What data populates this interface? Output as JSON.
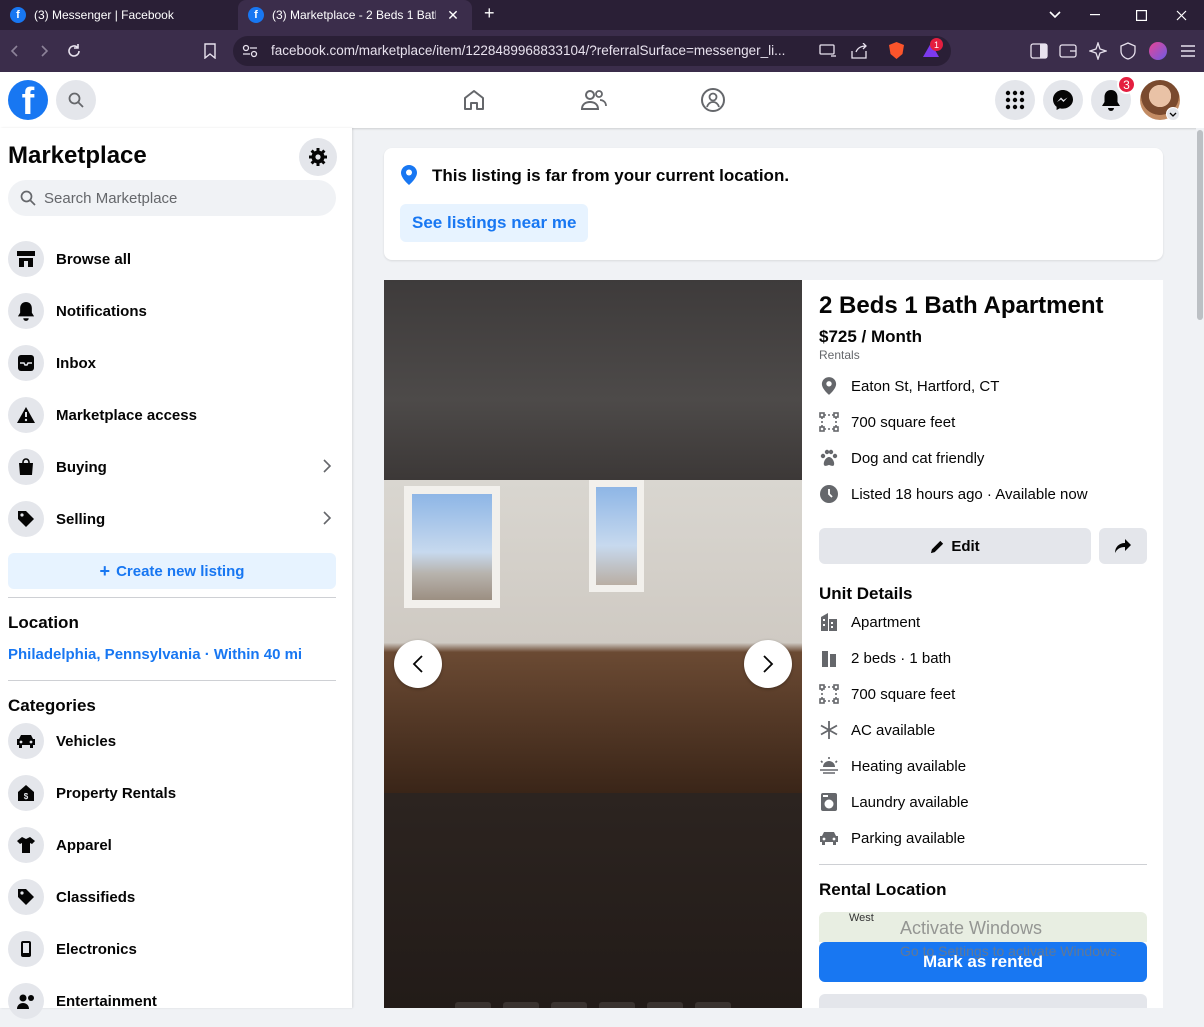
{
  "browser": {
    "tabs": [
      {
        "title": "(3) Messenger | Facebook",
        "active": false
      },
      {
        "title": "(3) Marketplace - 2 Beds 1 Bath",
        "active": true
      }
    ],
    "url": "facebook.com/marketplace/item/1228489968833104/?referralSurface=messenger_li...",
    "brave_badge": "1"
  },
  "fb": {
    "notification_count": "3"
  },
  "sidebar": {
    "title": "Marketplace",
    "search_placeholder": "Search Marketplace",
    "items": [
      {
        "label": "Browse all",
        "icon": "storefront-icon"
      },
      {
        "label": "Notifications",
        "icon": "bell-icon"
      },
      {
        "label": "Inbox",
        "icon": "inbox-icon"
      },
      {
        "label": "Marketplace access",
        "icon": "warning-icon"
      },
      {
        "label": "Buying",
        "icon": "shopping-bag-icon"
      },
      {
        "label": "Selling",
        "icon": "price-tag-icon"
      }
    ],
    "create_label": "Create new listing",
    "location_heading": "Location",
    "location_value": "Philadelphia, Pennsylvania · Within 40 mi",
    "categories_heading": "Categories",
    "categories": [
      {
        "label": "Vehicles",
        "icon": "car-icon"
      },
      {
        "label": "Property Rentals",
        "icon": "house-dollar-icon"
      },
      {
        "label": "Apparel",
        "icon": "shirt-icon"
      },
      {
        "label": "Classifieds",
        "icon": "tag-icon"
      },
      {
        "label": "Electronics",
        "icon": "phone-icon"
      },
      {
        "label": "Entertainment",
        "icon": "people-icon"
      }
    ]
  },
  "notice": {
    "message": "This listing is far from your current location.",
    "button": "See listings near me"
  },
  "listing": {
    "title": "2 Beds 1 Bath Apartment",
    "price": "$725 / Month",
    "category": "Rentals",
    "facts": [
      {
        "text": "Eaton St, Hartford, CT",
        "icon": "location-pin-icon"
      },
      {
        "text": "700 square feet",
        "icon": "area-icon"
      },
      {
        "text": "Dog and cat friendly",
        "icon": "paw-icon"
      },
      {
        "text": "Listed 18 hours ago · Available now",
        "icon": "clock-icon"
      }
    ],
    "edit_label": "Edit",
    "unit_details_heading": "Unit Details",
    "unit_details": [
      {
        "text": "Apartment",
        "icon": "building-icon"
      },
      {
        "text": "2 beds · 1 bath",
        "icon": "bed-icon"
      },
      {
        "text": "700 square feet",
        "icon": "area-icon"
      },
      {
        "text": "AC available",
        "icon": "snowflake-icon"
      },
      {
        "text": "Heating available",
        "icon": "heat-icon"
      },
      {
        "text": "Laundry available",
        "icon": "washer-icon"
      },
      {
        "text": "Parking available",
        "icon": "car-icon"
      }
    ],
    "rental_location_heading": "Rental Location",
    "map_label": "West",
    "mark_rented_label": "Mark as rented"
  },
  "watermark": {
    "line1": "Activate Windows",
    "line2": "Go to Settings to activate Windows."
  }
}
